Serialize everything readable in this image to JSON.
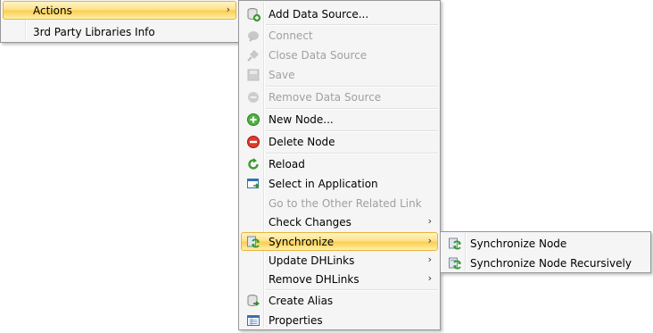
{
  "main_menu": {
    "items": [
      {
        "label": "Actions",
        "has_submenu": true,
        "highlighted": true
      },
      {
        "label": "3rd Party Libraries Info"
      }
    ]
  },
  "actions_menu": {
    "items": [
      {
        "label": "Add Data Source...",
        "icon": "add-database-icon"
      },
      {
        "label": "Connect",
        "icon": "connect-plug-icon",
        "disabled": true
      },
      {
        "label": "Close Data Source",
        "icon": "disconnect-plug-icon",
        "disabled": true
      },
      {
        "label": "Save",
        "icon": "save-icon",
        "disabled": true
      },
      {
        "label": "Remove Data Source",
        "icon": "remove-icon",
        "disabled": true
      },
      {
        "label": "New Node...",
        "icon": "add-green-circle-icon"
      },
      {
        "label": "Delete Node",
        "icon": "delete-red-circle-icon"
      },
      {
        "label": "Reload",
        "icon": "reload-icon"
      },
      {
        "label": "Select in Application",
        "icon": "select-in-app-icon"
      },
      {
        "label": "Go to the Other Related Link",
        "disabled": true
      },
      {
        "label": "Check Changes",
        "has_submenu": true
      },
      {
        "label": "Synchronize",
        "icon": "synchronize-icon",
        "has_submenu": true,
        "highlighted": true
      },
      {
        "label": "Update DHLinks",
        "has_submenu": true
      },
      {
        "label": "Remove DHLinks",
        "has_submenu": true
      },
      {
        "label": "Create Alias",
        "icon": "create-alias-icon"
      },
      {
        "label": "Properties",
        "icon": "properties-icon"
      }
    ]
  },
  "synchronize_menu": {
    "items": [
      {
        "label": "Synchronize Node",
        "icon": "synchronize-icon"
      },
      {
        "label": "Synchronize Node Recursively",
        "icon": "synchronize-recursive-icon"
      }
    ]
  },
  "submenu_arrow": "›",
  "colors": {
    "highlight_border": "#e8b53a",
    "highlight_fill": "#fde28c",
    "menu_background": "#f5f5f5",
    "disabled_text": "#a0a0a0"
  }
}
